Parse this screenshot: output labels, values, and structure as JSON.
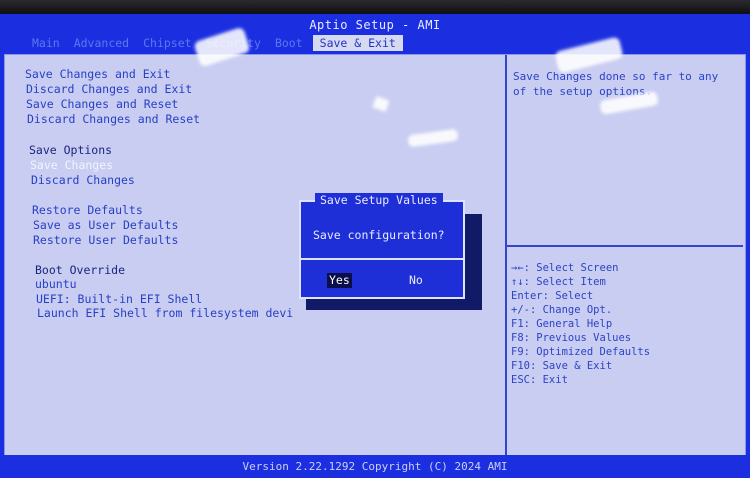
{
  "header": {
    "title": "Aptio Setup - AMI",
    "tabs": [
      {
        "label": "Main",
        "active": false
      },
      {
        "label": "Advanced",
        "active": false
      },
      {
        "label": "Chipset",
        "active": false
      },
      {
        "label": "Security",
        "active": false
      },
      {
        "label": "Boot",
        "active": false
      },
      {
        "label": "Save & Exit",
        "active": true
      }
    ]
  },
  "menu": {
    "items": [
      "Save Changes and Exit",
      "Discard Changes and Exit",
      "Save Changes and Reset",
      "Discard Changes and Reset",
      "Save Options",
      "Save Changes",
      "Discard Changes",
      "Restore Defaults",
      "Save as User Defaults",
      "Restore User Defaults",
      "Boot Override",
      "ubuntu",
      "UEFI: Built-in EFI Shell",
      "Launch EFI Shell from filesystem devi"
    ],
    "selected": "Save Changes"
  },
  "help": {
    "text": "Save Changes done so far to any of the setup options.",
    "keys": [
      "→←: Select Screen",
      "↑↓: Select Item",
      "Enter: Select",
      "+/-: Change Opt.",
      "F1: General Help",
      "F8: Previous Values",
      "F9: Optimized Defaults",
      "F10: Save & Exit",
      "ESC: Exit"
    ]
  },
  "dialog": {
    "title": "Save Setup Values",
    "message": "Save configuration?",
    "yes_label": "Yes",
    "no_label": "No",
    "focused": "Yes"
  },
  "footer": {
    "text": "Version 2.22.1292 Copyright (C) 2024 AMI"
  },
  "colors": {
    "background_blue": "#1c2fe0",
    "panel": "#c9cdf1",
    "text_blue": "#2740c6",
    "highlight_text": "#f2f4ff"
  }
}
